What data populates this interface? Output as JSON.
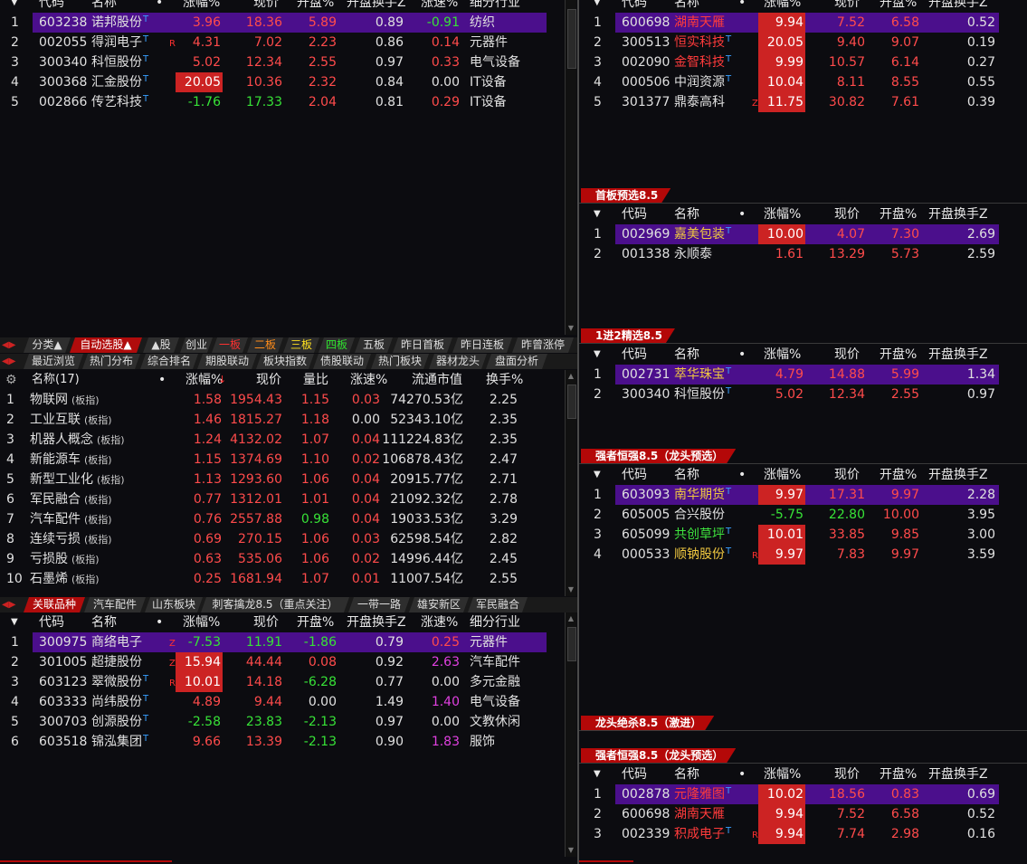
{
  "top_left": {
    "headers": [
      "代码",
      "名称",
      "•",
      "涨幅%",
      "现价",
      "开盘%",
      "开盘换手Z",
      "涨速%",
      "细分行业"
    ],
    "rows": [
      {
        "idx": "1",
        "code": "603238",
        "name": "诺邦股份",
        "t": "T",
        "flag": "",
        "chg": "3.96",
        "price": "18.36",
        "open": "5.89",
        "turn": "0.89",
        "speed": "-0.91",
        "industry": "纺织",
        "sel": true
      },
      {
        "idx": "2",
        "code": "002055",
        "name": "得润电子",
        "t": "T",
        "flag": "R",
        "chg": "4.31",
        "price": "7.02",
        "open": "2.23",
        "turn": "0.86",
        "speed": "0.14",
        "industry": "元器件"
      },
      {
        "idx": "3",
        "code": "300340",
        "name": "科恒股份",
        "t": "T",
        "flag": "",
        "chg": "5.02",
        "price": "12.34",
        "open": "2.55",
        "turn": "0.97",
        "speed": "0.33",
        "industry": "电气设备"
      },
      {
        "idx": "4",
        "code": "300368",
        "name": "汇金股份",
        "t": "T",
        "flag": "",
        "chg": "20.05",
        "price": "10.36",
        "open": "2.32",
        "turn": "0.84",
        "speed": "0.00",
        "industry": "IT设备"
      },
      {
        "idx": "5",
        "code": "002866",
        "name": "传艺科技",
        "t": "T",
        "flag": "",
        "chg": "-1.76",
        "price": "17.33",
        "open": "2.04",
        "turn": "0.81",
        "speed": "0.29",
        "industry": "IT设备"
      }
    ]
  },
  "tabs_row1": [
    "分类▲",
    "自动选股▲",
    "▲股",
    "创业",
    "一板",
    "二板",
    "三板",
    "四板",
    "五板",
    "昨日首板",
    "昨日连板",
    "昨曾涨停"
  ],
  "tabs_row2": [
    "最近浏览",
    "热门分布",
    "综合排名",
    "期股联动",
    "板块指数",
    "债股联动",
    "热门板块",
    "器材龙头",
    "盘面分析"
  ],
  "sector": {
    "headers": [
      "名称(17)",
      "•",
      "涨幅%",
      "现价",
      "量比",
      "涨速%",
      "流通市值",
      "换手%"
    ],
    "tag": "(板指)",
    "rows": [
      {
        "idx": "1",
        "name": "物联网",
        "chg": "1.58",
        "price": "1954.43",
        "vol": "1.15",
        "speed": "0.03",
        "cap": "74270.53亿",
        "turn": "2.25"
      },
      {
        "idx": "2",
        "name": "工业互联",
        "chg": "1.46",
        "price": "1815.27",
        "vol": "1.18",
        "speed": "0.00",
        "cap": "52343.10亿",
        "turn": "2.35"
      },
      {
        "idx": "3",
        "name": "机器人概念",
        "chg": "1.24",
        "price": "4132.02",
        "vol": "1.07",
        "speed": "0.04",
        "cap": "111224.83亿",
        "turn": "2.35"
      },
      {
        "idx": "4",
        "name": "新能源车",
        "chg": "1.15",
        "price": "1374.69",
        "vol": "1.10",
        "speed": "0.02",
        "cap": "106878.43亿",
        "turn": "2.47"
      },
      {
        "idx": "5",
        "name": "新型工业化",
        "chg": "1.13",
        "price": "1293.60",
        "vol": "1.06",
        "speed": "0.04",
        "cap": "20915.77亿",
        "turn": "2.71"
      },
      {
        "idx": "6",
        "name": "军民融合",
        "chg": "0.77",
        "price": "1312.01",
        "vol": "1.01",
        "speed": "0.04",
        "cap": "21092.32亿",
        "turn": "2.78"
      },
      {
        "idx": "7",
        "name": "汽车配件",
        "chg": "0.76",
        "price": "2557.88",
        "vol": "0.98",
        "speed": "0.04",
        "cap": "19033.53亿",
        "turn": "3.29"
      },
      {
        "idx": "8",
        "name": "连续亏损",
        "chg": "0.69",
        "price": "270.15",
        "vol": "1.06",
        "speed": "0.03",
        "cap": "62598.54亿",
        "turn": "2.82"
      },
      {
        "idx": "9",
        "name": "亏损股",
        "chg": "0.63",
        "price": "535.06",
        "vol": "1.06",
        "speed": "0.02",
        "cap": "14996.44亿",
        "turn": "2.45"
      },
      {
        "idx": "10",
        "name": "石墨烯",
        "chg": "0.25",
        "price": "1681.94",
        "vol": "1.07",
        "speed": "0.01",
        "cap": "11007.54亿",
        "turn": "2.55"
      }
    ]
  },
  "tabs_row3": [
    "关联品种",
    "汽车配件",
    "山东板块",
    "刺客擒龙8.5（重点关注）",
    "一带一路",
    "雄安新区",
    "军民融合"
  ],
  "related": {
    "headers": [
      "代码",
      "名称",
      "•",
      "涨幅%",
      "现价",
      "开盘%",
      "开盘换手Z",
      "涨速%",
      "细分行业"
    ],
    "rows": [
      {
        "idx": "1",
        "code": "300975",
        "name": "商络电子",
        "t": "",
        "flag": "Z",
        "chg": "-7.53",
        "price": "11.91",
        "open": "-1.86",
        "turn": "0.79",
        "speed": "0.25",
        "industry": "元器件",
        "sel": true
      },
      {
        "idx": "2",
        "code": "301005",
        "name": "超捷股份",
        "t": "",
        "flag": "Z",
        "chg": "15.94",
        "price": "44.44",
        "open": "0.08",
        "turn": "0.92",
        "speed": "2.63",
        "industry": "汽车配件"
      },
      {
        "idx": "3",
        "code": "603123",
        "name": "翠微股份",
        "t": "T",
        "flag": "R",
        "chg": "10.01",
        "price": "14.18",
        "open": "-6.28",
        "turn": "0.77",
        "speed": "0.00",
        "industry": "多元金融"
      },
      {
        "idx": "4",
        "code": "603333",
        "name": "尚纬股份",
        "t": "T",
        "flag": "",
        "chg": "4.89",
        "price": "9.44",
        "open": "0.00",
        "turn": "1.49",
        "speed": "1.40",
        "industry": "电气设备"
      },
      {
        "idx": "5",
        "code": "300703",
        "name": "创源股份",
        "t": "T",
        "flag": "",
        "chg": "-2.58",
        "price": "23.83",
        "open": "-2.13",
        "turn": "0.97",
        "speed": "0.00",
        "industry": "文教休闲"
      },
      {
        "idx": "6",
        "code": "603518",
        "name": "锦泓集团",
        "t": "T",
        "flag": "",
        "chg": "9.66",
        "price": "13.39",
        "open": "-2.13",
        "turn": "0.90",
        "speed": "1.83",
        "industry": "服饰"
      }
    ]
  },
  "right_headers": [
    "代码",
    "名称",
    "•",
    "涨幅%",
    "现价",
    "开盘%",
    "开盘换手Z"
  ],
  "right_top": [
    {
      "idx": "1",
      "code": "600698",
      "name": "湖南天雁",
      "t": "",
      "flag": "",
      "chg": "9.94",
      "price": "7.52",
      "open": "6.58",
      "turn": "0.52",
      "sel": true
    },
    {
      "idx": "2",
      "code": "300513",
      "name": "恒实科技",
      "t": "T",
      "flag": "",
      "chg": "20.05",
      "price": "9.40",
      "open": "9.07",
      "turn": "0.19"
    },
    {
      "idx": "3",
      "code": "002090",
      "name": "金智科技",
      "t": "T",
      "flag": "",
      "chg": "9.99",
      "price": "10.57",
      "open": "6.14",
      "turn": "0.27"
    },
    {
      "idx": "4",
      "code": "000506",
      "name": "中润资源",
      "t": "T",
      "flag": "",
      "chg": "10.04",
      "price": "8.11",
      "open": "8.55",
      "turn": "0.55"
    },
    {
      "idx": "5",
      "code": "301377",
      "name": "鼎泰高科",
      "t": "",
      "flag": "Z",
      "chg": "11.75",
      "price": "30.82",
      "open": "7.61",
      "turn": "0.39"
    }
  ],
  "panel_first": {
    "title": "首板预选8.5",
    "rows": [
      {
        "idx": "1",
        "code": "002969",
        "name": "嘉美包装",
        "t": "T",
        "flag": "",
        "chg": "10.00",
        "price": "4.07",
        "open": "7.30",
        "turn": "2.69",
        "sel": true
      },
      {
        "idx": "2",
        "code": "001338",
        "name": "永顺泰",
        "t": "",
        "flag": "",
        "chg": "1.61",
        "price": "13.29",
        "open": "5.73",
        "turn": "2.59"
      }
    ]
  },
  "panel_second": {
    "title": "1进2精选8.5",
    "rows": [
      {
        "idx": "1",
        "code": "002731",
        "name": "萃华珠宝",
        "t": "T",
        "flag": "",
        "chg": "4.79",
        "price": "14.88",
        "open": "5.99",
        "turn": "1.34",
        "sel": true
      },
      {
        "idx": "2",
        "code": "300340",
        "name": "科恒股份",
        "t": "T",
        "flag": "",
        "chg": "5.02",
        "price": "12.34",
        "open": "2.55",
        "turn": "0.97"
      }
    ]
  },
  "panel_strong": {
    "title": "强者恒强8.5（龙头预选）",
    "rows": [
      {
        "idx": "1",
        "code": "603093",
        "name": "南华期货",
        "t": "T",
        "flag": "",
        "chg": "9.97",
        "price": "17.31",
        "open": "9.97",
        "turn": "2.28",
        "sel": true
      },
      {
        "idx": "2",
        "code": "605005",
        "name": "合兴股份",
        "t": "",
        "flag": "",
        "chg": "-5.75",
        "price": "22.80",
        "open": "10.00",
        "turn": "3.95"
      },
      {
        "idx": "3",
        "code": "605099",
        "name": "共创草坪",
        "t": "T",
        "flag": "",
        "chg": "10.01",
        "price": "33.85",
        "open": "9.85",
        "turn": "3.00"
      },
      {
        "idx": "4",
        "code": "000533",
        "name": "顺钠股份",
        "t": "T",
        "flag": "R",
        "chg": "9.97",
        "price": "7.83",
        "open": "9.97",
        "turn": "3.59"
      }
    ]
  },
  "panel_kill": {
    "title": "龙头绝杀8.5（激进）"
  },
  "panel_strong2": {
    "title": "强者恒强8.5（龙头预选）",
    "rows": [
      {
        "idx": "1",
        "code": "002878",
        "name": "元隆雅图",
        "t": "T",
        "flag": "",
        "chg": "10.02",
        "price": "18.56",
        "open": "0.83",
        "turn": "0.69",
        "sel": true
      },
      {
        "idx": "2",
        "code": "600698",
        "name": "湖南天雁",
        "t": "",
        "flag": "",
        "chg": "9.94",
        "price": "7.52",
        "open": "6.58",
        "turn": "0.52"
      },
      {
        "idx": "3",
        "code": "002339",
        "name": "积成电子",
        "t": "T",
        "flag": "R",
        "chg": "9.94",
        "price": "7.74",
        "open": "2.98",
        "turn": "0.16"
      }
    ]
  }
}
